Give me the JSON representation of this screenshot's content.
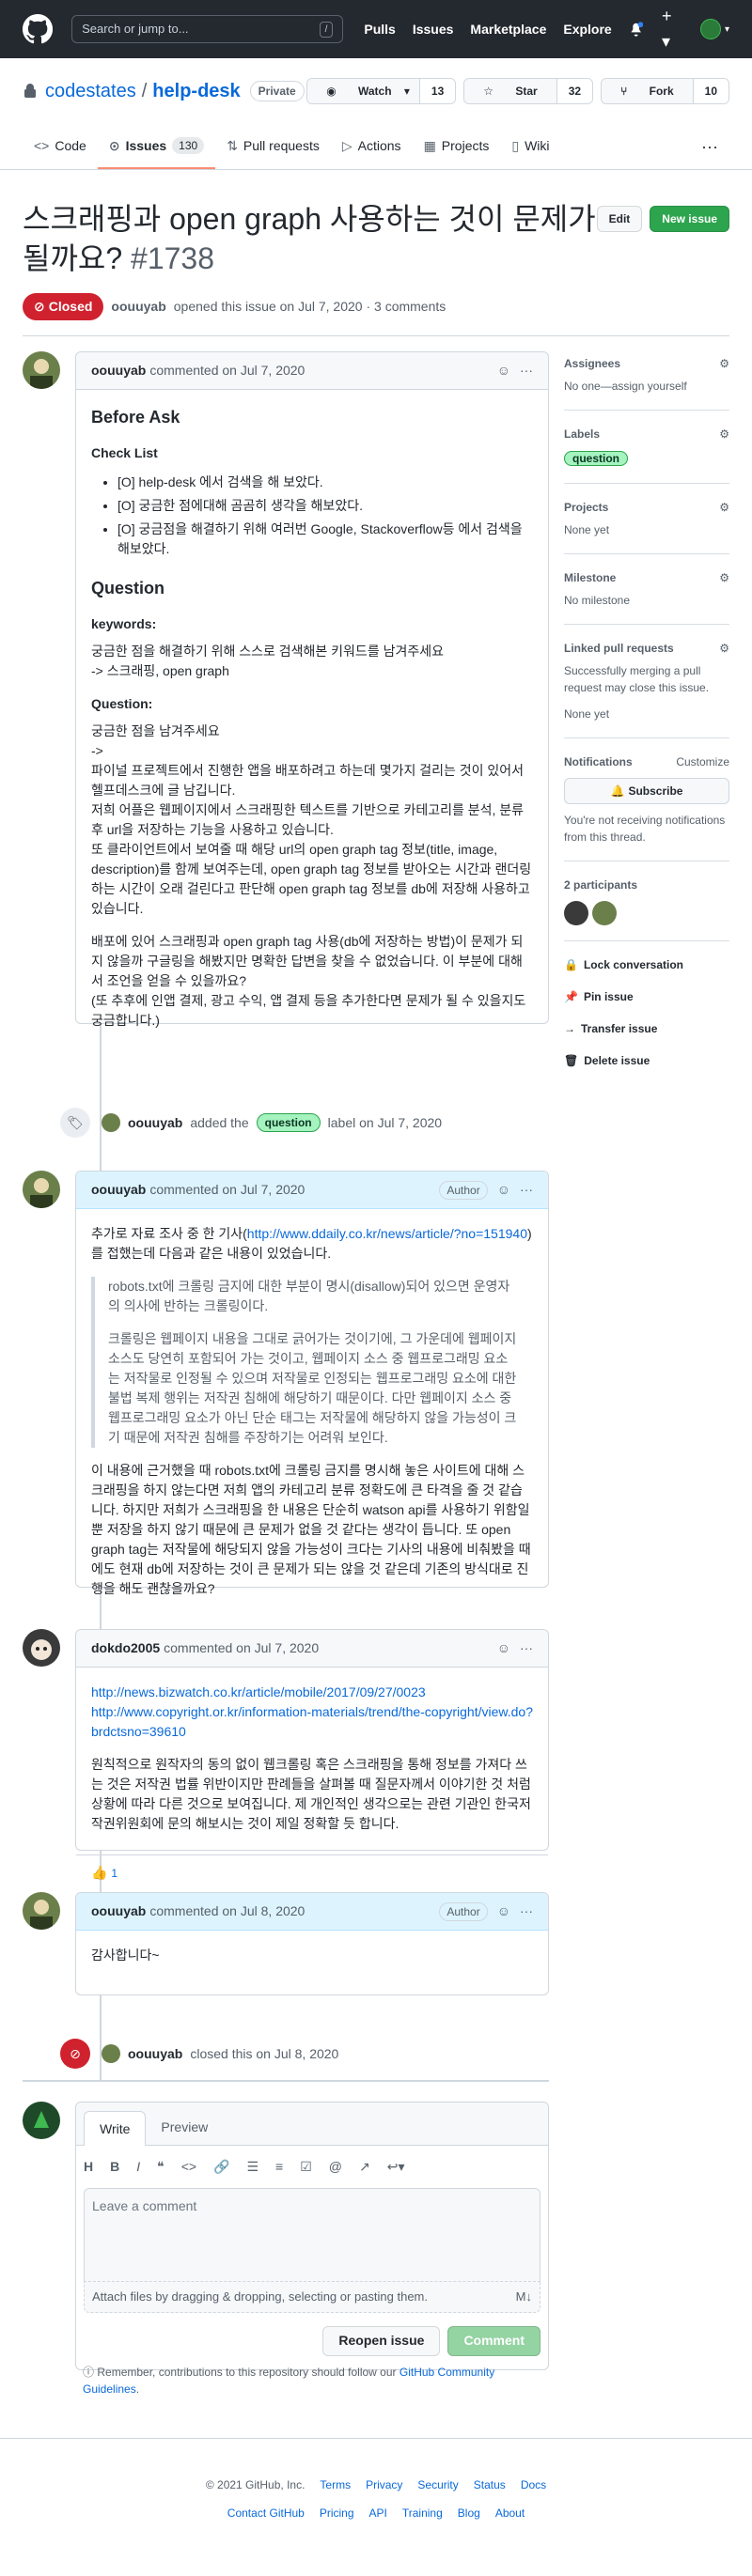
{
  "header": {
    "search_placeholder": "Search or jump to...",
    "slash": "/",
    "nav": [
      "Pulls",
      "Issues",
      "Marketplace",
      "Explore"
    ]
  },
  "repo": {
    "owner": "codestates",
    "sep": "/",
    "name": "help-desk",
    "visibility": "Private",
    "watch": {
      "label": "Watch",
      "count": "13"
    },
    "star": {
      "label": "Star",
      "count": "32"
    },
    "fork": {
      "label": "Fork",
      "count": "10"
    },
    "tabs": [
      {
        "label": "Code"
      },
      {
        "label": "Issues",
        "count": "130"
      },
      {
        "label": "Pull requests"
      },
      {
        "label": "Actions"
      },
      {
        "label": "Projects"
      },
      {
        "label": "Wiki"
      }
    ]
  },
  "issue": {
    "title": "스크래핑과 open graph 사용하는 것이 문제가 될까요?",
    "number": "#1738",
    "edit": "Edit",
    "new_issue": "New issue",
    "state": "Closed",
    "author": "oouuyab",
    "meta_rest": "opened this issue on Jul 7, 2020 · 3 comments"
  },
  "comment1": {
    "author": "oouuyab",
    "date": "commented on Jul 7, 2020",
    "h2a": "Before Ask",
    "h3": "Check List",
    "checklist": [
      "[O] help-desk 에서 검색을 해 보았다.",
      "[O] 궁금한 점에대해 곰곰히 생각을 해보았다.",
      "[O] 궁금점을 해결하기 위해 여러번 Google, Stackoverflow등 에서 검색을 해보았다."
    ],
    "h2b": "Question",
    "kw_h": "keywords:",
    "kw_p1": "궁금한 점을 해결하기 위해 스스로 검색해본 키워드를 남겨주세요",
    "kw_p2": "-> 스크래핑, open graph",
    "q_h": "Question:",
    "q_l1": "궁금한 점을 남겨주세요",
    "q_l2": "->",
    "q_l3": "파이널 프로젝트에서 진행한 앱을 배포하려고 하는데 몇가지 걸리는 것이 있어서 헬프데스크에 글 남깁니다.",
    "q_l4": "저희 어플은 웹페이지에서 스크래핑한 텍스트를 기반으로 카테고리를 분석, 분류 후 url을 저장하는 기능을 사용하고 있습니다.",
    "q_l5": "또 클라이언트에서 보여줄 때 해당 url의 open graph tag 정보(title, image, description)를 함께 보여주는데, open graph tag 정보를 받아오는 시간과 랜더링하는 시간이 오래 걸린다고 판단해 open graph tag 정보를 db에 저장해 사용하고 있습니다.",
    "q_p2": "배포에 있어 스크래핑과 open graph tag 사용(db에 저장하는 방법)이 문제가 되지 않을까 구글링을 해봤지만 명확한 답변을 찾을 수 없었습니다. 이 부분에 대해서 조언을 얻을 수 있을까요?",
    "q_p3": "(또 추후에 인앱 결제, 광고 수익, 앱 결제 등을 추가한다면 문제가 될 수 있을지도 궁금합니다.)"
  },
  "event1": {
    "author": "oouuyab",
    "pre": "added the",
    "label": "question",
    "post": "label on Jul 7, 2020"
  },
  "comment2": {
    "author": "oouuyab",
    "date": "commented on Jul 7, 2020",
    "tag": "Author",
    "p1a": "추가로 자료 조사 중 한 기사(",
    "link": "http://www.ddaily.co.kr/news/article/?no=151940",
    "p1b": ")를 접했는데 다음과 같은 내용이 있었습니다.",
    "bq1": "robots.txt에 크롤링 금지에 대한 부분이 명시(disallow)되어 있으면 운영자의 의사에 반하는 크롤링이다.",
    "bq2": "크롤링은 웹페이지 내용을 그대로 긁어가는 것이기에, 그 가운데에 웹페이지 소스도 당연히 포함되어 가는 것이고, 웹페이지 소스 중 웹프로그래밍 요소는 저작물로 인정될 수 있으며 저작물로 인정되는 웹프로그래밍 요소에 대한 불법 복제 행위는 저작권 침해에 해당하기 때문이다. 다만 웹페이지 소스 중 웹프로그래밍 요소가 아닌 단순 태그는 저작물에 해당하지 않을 가능성이 크기 때문에 저작권 침해를 주장하기는 어려워 보인다.",
    "p2": "이 내용에 근거했을 때 robots.txt에 크롤링 금지를 명시해 놓은 사이트에 대해 스크래핑을 하지 않는다면 저희 앱의 카테고리 분류 정확도에 큰 타격을 줄 것 같습니다. 하지만 저희가 스크래핑을 한 내용은 단순히 watson api를 사용하기 위함일 뿐 저장을 하지 않기 때문에 큰 문제가 없을 것 같다는 생각이 듭니다. 또 open graph tag는 저작물에 해당되지 않을 가능성이 크다는 기사의 내용에 비춰봤을 때에도 현재 db에 저장하는 것이 큰 문제가 되는 않을 것 같은데 기존의 방식대로 진행을 해도 괜찮을까요?"
  },
  "comment3": {
    "author": "dokdo2005",
    "date": "commented on Jul 7, 2020",
    "link1": "http://news.bizwatch.co.kr/article/mobile/2017/09/27/0023",
    "link2": "http://www.copyright.or.kr/information-materials/trend/the-copyright/view.do?brdctsno=39610",
    "p": "원칙적으로 원작자의 동의 없이 웹크롤링 혹은 스크래핑을 통해 정보를 가져다 쓰는 것은 저작권 법률 위반이지만 판례들을 살펴볼 때 질문자께서 이야기한 것 처럼 상황에 따라 다른 것으로 보여집니다. 제 개인적인 생각으로는 관련 기관인 한국저작권위원회에 문의 해보시는 것이 제일 정확할 듯 합니다.",
    "reaction_emoji": "👍",
    "reaction_count": "1"
  },
  "comment4": {
    "author": "oouuyab",
    "date": "commented on Jul 8, 2020",
    "tag": "Author",
    "body": "감사합니다~"
  },
  "event2": {
    "author": "oouuyab",
    "rest": "closed this on Jul 8, 2020"
  },
  "composer": {
    "tab_write": "Write",
    "tab_preview": "Preview",
    "placeholder": "Leave a comment",
    "attach": "Attach files by dragging & dropping, selecting or pasting them.",
    "md": "M↓",
    "reopen": "Reopen issue",
    "comment": "Comment"
  },
  "note": {
    "text": "Remember, contributions to this repository should follow our ",
    "link": "GitHub Community Guidelines",
    "end": "."
  },
  "sidebar": {
    "assignees_h": "Assignees",
    "assignees_t": "No one—assign yourself",
    "labels_h": "Labels",
    "label": "question",
    "projects_h": "Projects",
    "projects_t": "None yet",
    "milestone_h": "Milestone",
    "milestone_t": "No milestone",
    "linked_h": "Linked pull requests",
    "linked_t": "Successfully merging a pull request may close this issue.",
    "linked_t2": "None yet",
    "notif_h": "Notifications",
    "customize": "Customize",
    "subscribe": "Subscribe",
    "notif_t": "You're not receiving notifications from this thread.",
    "participants_h": "2 participants",
    "lock": "Lock conversation",
    "pin": "Pin issue",
    "transfer": "Transfer issue",
    "delete": "Delete issue"
  },
  "footer": {
    "copy": "© 2021 GitHub, Inc.",
    "row1": [
      "Terms",
      "Privacy",
      "Security",
      "Status",
      "Docs"
    ],
    "row2": [
      "Contact GitHub",
      "Pricing",
      "API",
      "Training",
      "Blog",
      "About"
    ]
  },
  "colors": {
    "header": "#24292f",
    "closed": "#cf222e",
    "green": "#2da44e",
    "link": "#0969da"
  }
}
